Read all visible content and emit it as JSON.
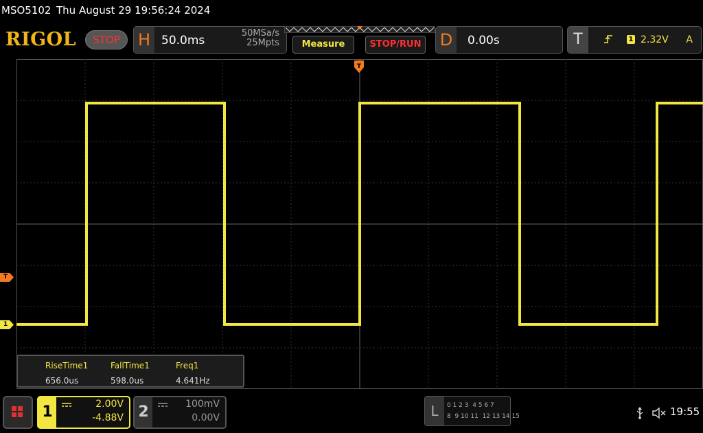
{
  "header": {
    "model": "MSO5102",
    "datetime": "Thu August 29 19:56:24 2024"
  },
  "toolbar": {
    "logo": "RIGOL",
    "run_state": "STOP",
    "horizontal": {
      "badge": "H",
      "timebase": "50.0ms",
      "sample_rate": "50MSa/s",
      "memory_depth": "25Mpts"
    },
    "measure_label": "Measure",
    "stop_run_label": "STOP/RUN",
    "delay": {
      "badge": "D",
      "value": "0.00s"
    },
    "trigger": {
      "badge": "T",
      "source": "1",
      "level": "2.32V",
      "mode": "A",
      "edge_icon": "rising-edge-icon"
    }
  },
  "markers": {
    "trigger_level": "T",
    "channel1_ground": "1"
  },
  "measurements": {
    "labels": [
      "RiseTime1",
      "FallTime1",
      "Freq1"
    ],
    "values": [
      "656.0us",
      "598.0us",
      "4.641Hz"
    ]
  },
  "channels": [
    {
      "number": "1",
      "scale": "2.00V",
      "offset": "-4.88V",
      "color": "#f2e642",
      "active": true
    },
    {
      "number": "2",
      "scale": "100mV",
      "offset": "0.00V",
      "color": "#999999",
      "active": false
    }
  ],
  "logic_analyzer": {
    "badge": "L",
    "row1": "0 1 2 3  4 5 6 7",
    "row2": "8  9 10 11  12 13 14 15"
  },
  "status": {
    "usb_icon": "usb-icon",
    "speaker_icon": "speaker-muted-icon",
    "time": "19:55"
  },
  "waveform": {
    "color": "#f2e642",
    "transitions": [
      {
        "t": 0.102,
        "level": "high"
      },
      {
        "t": 0.303,
        "level": "low"
      },
      {
        "t": 0.5,
        "level": "high"
      },
      {
        "t": 0.733,
        "level": "low"
      },
      {
        "t": 0.933,
        "level": "high"
      }
    ],
    "initial_level": "low"
  }
}
